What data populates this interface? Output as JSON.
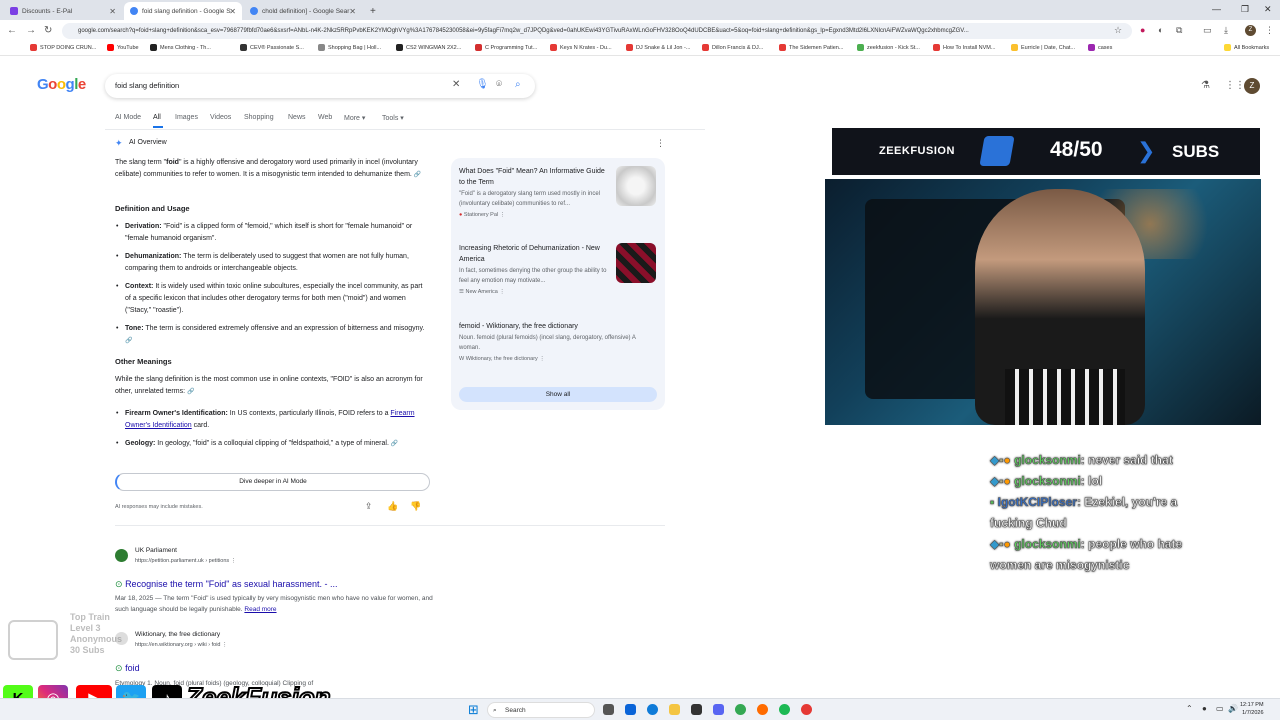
{
  "browser": {
    "tabs": [
      {
        "title": "Discounts - E-Pal",
        "active": false
      },
      {
        "title": "foid slang definition - Google S",
        "active": true
      },
      {
        "title": "chold definition] - Google Sear",
        "active": false
      }
    ],
    "url": "google.com/search?q=foid+slang+definition&sca_esv=7968779fbfd70ae6&sxsrf=ANbL-n4K-2Nkz5RRpPvbKEK2YMOghVYg%3A1767845230058&ei=9y5fagFi7mq2w_d7JPQDg&ved=0ahUKEwi43YGTivuRAxWLnGoFHV328OoQ4dUDCBE&uact=5&oq=foid+slang+definition&gs_lp=Egxnd3Mtd2l6LXNlcnAiFWZvaWQgc2xhbmcgZGV...",
    "bookmarks": [
      "STOP DOING CRUN...",
      "YouTube",
      "Mens Clothing - Th...",
      "CEV® Passionate S...",
      "Shopping Bag | Holl...",
      "CS2 WINGMAN 2X2...",
      "C Programming Tut...",
      "Keys N Krates - Du...",
      "DJ Snake & Lil Jon -...",
      "Dillon Francis & DJ...",
      "The Sidemen Patien...",
      "zeekfusion - Kick St...",
      "How To Install NVM...",
      "Eurricle | Date, Chat...",
      "cases"
    ],
    "all_bookmarks": "All Bookmarks"
  },
  "google": {
    "logo": "Google",
    "query": "foid slang definition",
    "tabs": [
      "AI Mode",
      "All",
      "Images",
      "Videos",
      "Shopping",
      "News",
      "Web",
      "More",
      "Tools"
    ],
    "avatar_letter": "Z"
  },
  "ai_overview": {
    "label": "AI Overview",
    "intro_pre": "The slang term \"",
    "intro_term": "foid",
    "intro_post": "\" is a highly offensive and derogatory word used primarily in incel (involuntary celibate) communities to refer to women. It is a misogynistic term intended to dehumanize them.",
    "section1": "Definition and Usage",
    "bullets1": [
      {
        "label": "Derivation:",
        "text": " \"Foid\" is a clipped form of \"femoid,\" which itself is short for \"female humanoid\" or \"female humanoid organism\"."
      },
      {
        "label": "Dehumanization:",
        "text": " The term is deliberately used to suggest that women are not fully human, comparing them to androids or interchangeable objects."
      },
      {
        "label": "Context:",
        "text": " It is widely used within toxic online subcultures, especially the incel community, as part of a specific lexicon that includes other derogatory terms for both men (\"moid\") and women (\"Stacy,\" \"roastie\")."
      },
      {
        "label": "Tone:",
        "text": " The term is considered extremely offensive and an expression of bitterness and misogyny."
      }
    ],
    "section2": "Other Meanings",
    "other_intro": "While the slang definition is the most common use in online contexts, \"FOID\" is also an acronym for other, unrelated terms:",
    "bullets2": [
      {
        "label": "Firearm Owner's Identification:",
        "text": " In US contexts, particularly Illinois, FOID refers to a ",
        "link": "Firearm Owner's Identification",
        "tail": " card."
      },
      {
        "label": "Geology:",
        "text": " In geology, \"foid\" is a colloquial clipping of \"feldspathoid,\" a type of mineral."
      }
    ],
    "dive_button": "Dive deeper in AI Mode",
    "disclaimer": "AI responses may include mistakes."
  },
  "sources": [
    {
      "title": "What Does \"Foid\" Mean? An Informative Guide to the Term",
      "snippet": "\"Foid\" is a derogatory slang term used mostly in incel (involuntary celibate) communities to ref...",
      "site": "Stationery Pal"
    },
    {
      "title": "Increasing Rhetoric of Dehumanization - New America",
      "snippet": "In fact, sometimes denying the other group the ability to feel any emotion may motivate...",
      "site": "New America"
    },
    {
      "title": "femoid - Wiktionary, the free dictionary",
      "snippet": "Noun. femoid (plural femoids) (incel slang, derogatory, offensive) A woman.",
      "site": "Wiktionary, the free dictionary"
    }
  ],
  "show_all": "Show all",
  "results": [
    {
      "site": "UK Parliament",
      "url": "https://petition.parliament.uk › petitions",
      "title": "Recognise the term \"Foid\" as sexual harassment. - ...",
      "date": "Mar 18, 2025",
      "snippet": " — The term \"Foid\" is used typically by very misogynistic men who have no value for women, and such language should be legally punishable.",
      "read_more": "Read more"
    },
    {
      "site": "Wiktionary, the free dictionary",
      "url": "https://en.wiktionary.org › wiki › foid",
      "title": "foid",
      "snippet": "Etymology 1. Noun. foid (plural foids) (geology, colloquial) Clipping of"
    }
  ],
  "stream": {
    "brand": "ZEEKFUSION",
    "sub_count": "48/50",
    "sub_unit": "SUBS",
    "chat": [
      {
        "user": "glocksonmi",
        "message": ": never said that",
        "style": "green"
      },
      {
        "user": "glocksonmi",
        "message": ": lol",
        "style": "green"
      },
      {
        "user": "IgotKCIPloser",
        "message": ": Ezekiel, you're a fucking Chud",
        "style": "blue"
      },
      {
        "user": "glocksonmi",
        "message": ": people who hate women are misogynistic",
        "style": "green"
      }
    ],
    "top_train": [
      "Top Train",
      "Level 3",
      "Anonymous",
      "30 Subs"
    ],
    "social_name": "ZeekFusion"
  },
  "taskbar": {
    "search": "Search",
    "time": "12:17 PM",
    "date": "1/7/2026"
  },
  "colors": {
    "accent": "#1a73e8",
    "link": "#1a0dab",
    "chat_green": "#5bd75b",
    "chat_blue": "#2f6fd0"
  }
}
